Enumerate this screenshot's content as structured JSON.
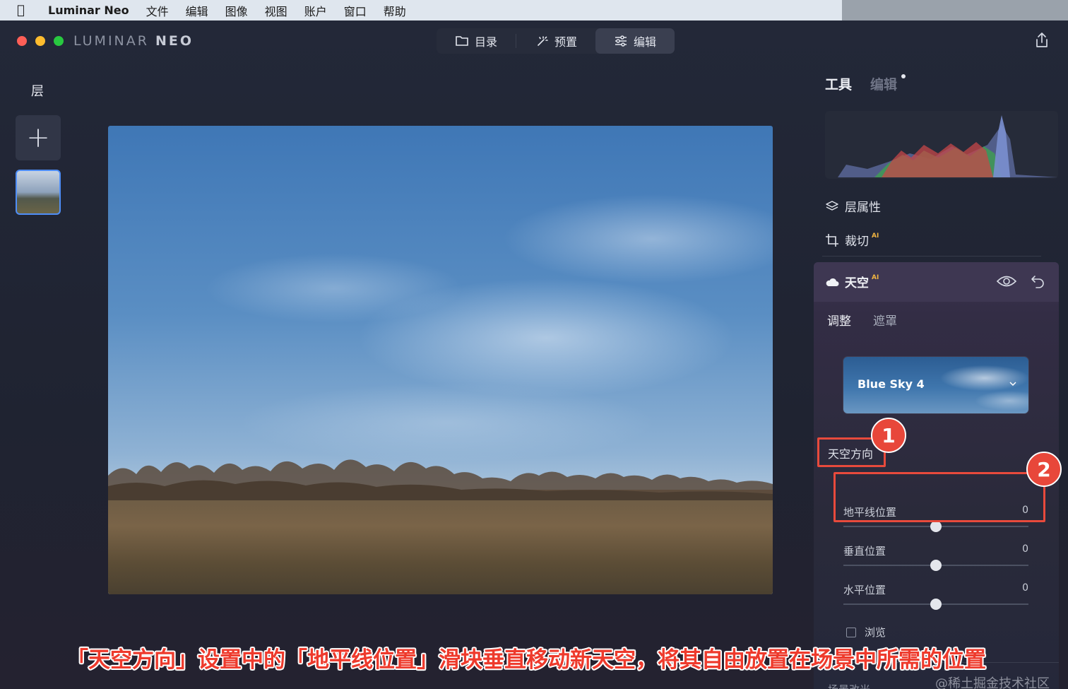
{
  "menubar": {
    "app_name": "Luminar Neo",
    "items": [
      "文件",
      "编辑",
      "图像",
      "视图",
      "账户",
      "窗口",
      "帮助"
    ]
  },
  "window": {
    "brand_left": "LUMINAR",
    "brand_right": "NEO",
    "nav": [
      {
        "label": "目录",
        "icon": "folder-icon"
      },
      {
        "label": "预置",
        "icon": "magic-wand-icon"
      },
      {
        "label": "编辑",
        "icon": "sliders-icon",
        "active": true
      }
    ]
  },
  "layers": {
    "title": "层"
  },
  "right_panel": {
    "tab_tools": "工具",
    "tab_edit": "编辑",
    "layer_properties": "层属性",
    "crop": "裁切",
    "ai_badge": "AI",
    "sky": {
      "title": "天空",
      "subtab_adjust": "调整",
      "subtab_mask": "遮罩",
      "sky_choice": "Blue Sky 4",
      "section_orientation": "天空方向",
      "sliders": [
        {
          "label": "地平线位置",
          "value": "0",
          "position": 0.5
        },
        {
          "label": "垂直位置",
          "value": "0",
          "position": 0.5
        },
        {
          "label": "水平位置",
          "value": "0",
          "position": 0.5
        }
      ],
      "preview_label": "浏览",
      "bottom_label": "场景改光"
    }
  },
  "annotations": {
    "badge_1": "1",
    "badge_2": "2",
    "caption": "「天空方向」设置中的「地平线位置」滑块垂直移动新天空，将其自由放置在场景中所需的位置",
    "watermark": "@稀土掘金技术社区",
    "accent_color": "#e8473a"
  }
}
